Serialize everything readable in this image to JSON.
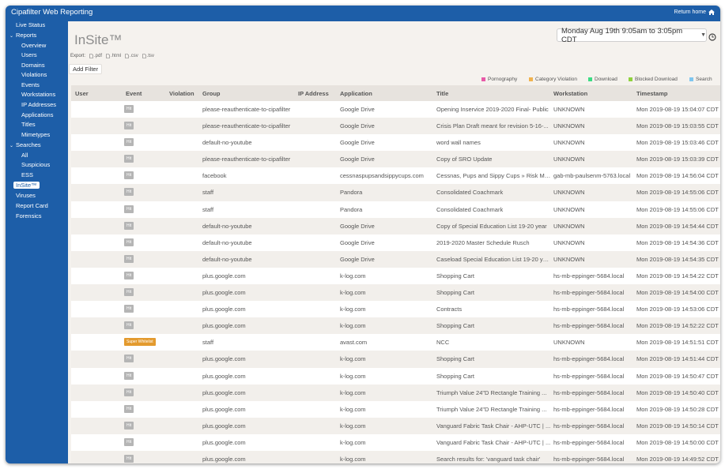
{
  "app": {
    "title": "Cipafilter Web Reporting",
    "return_home": "Return home"
  },
  "sidebar": {
    "live_status": "Live Status",
    "reports": "Reports",
    "overview": "Overview",
    "users": "Users",
    "domains": "Domains",
    "violations": "Violations",
    "events": "Events",
    "workstations": "Workstations",
    "ip_addresses": "IP Addresses",
    "applications": "Applications",
    "titles": "Titles",
    "mimetypes": "Mimetypes",
    "searches": "Searches",
    "all": "All",
    "suspicious": "Suspicious",
    "ess": "ESS",
    "insite": "InSite™",
    "viruses": "Viruses",
    "report_card": "Report Card",
    "forensics": "Forensics"
  },
  "page": {
    "title": "InSite™",
    "date_range": "Monday Aug 19th 9:05am to 3:05pm CDT",
    "export_label": "Export:",
    "export_options": [
      ".pdf",
      ".html",
      ".csv",
      ".tsv"
    ],
    "add_filter": "Add Filter"
  },
  "legend": [
    {
      "label": "Pornography",
      "color": "#e85aa8"
    },
    {
      "label": "Category Violation",
      "color": "#f0b24e"
    },
    {
      "label": "Download",
      "color": "#3ddc84"
    },
    {
      "label": "Blocked Download",
      "color": "#8fd23e"
    },
    {
      "label": "Search",
      "color": "#7fc6ef"
    }
  ],
  "table": {
    "columns": [
      "User",
      "Event",
      "Violation",
      "Group",
      "IP Address",
      "Application",
      "Title",
      "Workstation",
      "Timestamp"
    ],
    "rows": [
      {
        "event": "Hit",
        "group": "please-reauthenticate-to-cipafilter",
        "application": "Google Drive",
        "title": "Opening Inservice 2019-2020 Final- Public",
        "workstation": "UNKNOWN",
        "timestamp": "Mon 2019-08-19 15:04:07 CDT"
      },
      {
        "event": "Hit",
        "group": "please-reauthenticate-to-cipafilter",
        "application": "Google Drive",
        "title": "Crisis Plan Draft meant for revision 5-16-...",
        "workstation": "UNKNOWN",
        "timestamp": "Mon 2019-08-19 15:03:55 CDT"
      },
      {
        "event": "Hit",
        "group": "default-no-youtube",
        "application": "Google Drive",
        "title": "word wall names",
        "workstation": "UNKNOWN",
        "timestamp": "Mon 2019-08-19 15:03:46 CDT"
      },
      {
        "event": "Hit",
        "group": "please-reauthenticate-to-cipafilter",
        "application": "Google Drive",
        "title": "Copy of SRO Update",
        "workstation": "UNKNOWN",
        "timestamp": "Mon 2019-08-19 15:03:39 CDT"
      },
      {
        "event": "Hit",
        "group": "facebook",
        "application": "cessnaspupsandsippycups.com",
        "title": "Cessnas, Pups and Sippy Cups » Risk Ma...",
        "workstation": "gab-mb-paulsenm-5763.local",
        "timestamp": "Mon 2019-08-19 14:56:04 CDT"
      },
      {
        "event": "Hit",
        "group": "staff",
        "application": "Pandora",
        "title": "Consolidated Coachmark",
        "workstation": "UNKNOWN",
        "timestamp": "Mon 2019-08-19 14:55:06 CDT"
      },
      {
        "event": "Hit",
        "group": "staff",
        "application": "Pandora",
        "title": "Consolidated Coachmark",
        "workstation": "UNKNOWN",
        "timestamp": "Mon 2019-08-19 14:55:06 CDT"
      },
      {
        "event": "Hit",
        "group": "default-no-youtube",
        "application": "Google Drive",
        "title": "Copy of Special Education List 19-20 year",
        "workstation": "UNKNOWN",
        "timestamp": "Mon 2019-08-19 14:54:44 CDT"
      },
      {
        "event": "Hit",
        "group": "default-no-youtube",
        "application": "Google Drive",
        "title": "2019-2020 Master Schedule Rusch",
        "workstation": "UNKNOWN",
        "timestamp": "Mon 2019-08-19 14:54:36 CDT"
      },
      {
        "event": "Hit",
        "group": "default-no-youtube",
        "application": "Google Drive",
        "title": "Caseload Special Education List 19-20 ye...",
        "workstation": "UNKNOWN",
        "timestamp": "Mon 2019-08-19 14:54:35 CDT"
      },
      {
        "event": "Hit",
        "group": "plus.google.com",
        "application": "k-log.com",
        "title": "Shopping Cart",
        "workstation": "hs-mb-eppinger-5684.local",
        "timestamp": "Mon 2019-08-19 14:54:22 CDT"
      },
      {
        "event": "Hit",
        "group": "plus.google.com",
        "application": "k-log.com",
        "title": "Shopping Cart",
        "workstation": "hs-mb-eppinger-5684.local",
        "timestamp": "Mon 2019-08-19 14:54:00 CDT"
      },
      {
        "event": "Hit",
        "group": "plus.google.com",
        "application": "k-log.com",
        "title": "Contracts",
        "workstation": "hs-mb-eppinger-5684.local",
        "timestamp": "Mon 2019-08-19 14:53:06 CDT"
      },
      {
        "event": "Hit",
        "group": "plus.google.com",
        "application": "k-log.com",
        "title": "Shopping Cart",
        "workstation": "hs-mb-eppinger-5684.local",
        "timestamp": "Mon 2019-08-19 14:52:22 CDT"
      },
      {
        "event": "Super Whitelist",
        "group": "staff",
        "application": "avast.com",
        "title": "NCC",
        "workstation": "UNKNOWN",
        "timestamp": "Mon 2019-08-19 14:51:51 CDT"
      },
      {
        "event": "Hit",
        "group": "plus.google.com",
        "application": "k-log.com",
        "title": "Shopping Cart",
        "workstation": "hs-mb-eppinger-5684.local",
        "timestamp": "Mon 2019-08-19 14:51:44 CDT"
      },
      {
        "event": "Hit",
        "group": "plus.google.com",
        "application": "k-log.com",
        "title": "Shopping Cart",
        "workstation": "hs-mb-eppinger-5684.local",
        "timestamp": "Mon 2019-08-19 14:50:47 CDT"
      },
      {
        "event": "Hit",
        "group": "plus.google.com",
        "application": "k-log.com",
        "title": "Triumph Value 24\"D Rectangle Training ...",
        "workstation": "hs-mb-eppinger-5684.local",
        "timestamp": "Mon 2019-08-19 14:50:40 CDT"
      },
      {
        "event": "Hit",
        "group": "plus.google.com",
        "application": "k-log.com",
        "title": "Triumph Value 24\"D Rectangle Training ...",
        "workstation": "hs-mb-eppinger-5684.local",
        "timestamp": "Mon 2019-08-19 14:50:28 CDT"
      },
      {
        "event": "Hit",
        "group": "plus.google.com",
        "application": "k-log.com",
        "title": "Vanguard Fabric Task Chair - AHP-UTC | ...",
        "workstation": "hs-mb-eppinger-5684.local",
        "timestamp": "Mon 2019-08-19 14:50:14 CDT"
      },
      {
        "event": "Hit",
        "group": "plus.google.com",
        "application": "k-log.com",
        "title": "Vanguard Fabric Task Chair - AHP-UTC | ...",
        "workstation": "hs-mb-eppinger-5684.local",
        "timestamp": "Mon 2019-08-19 14:50:00 CDT"
      },
      {
        "event": "Hit",
        "group": "plus.google.com",
        "application": "k-log.com",
        "title": "Search results for: 'vanguard task chair'",
        "workstation": "hs-mb-eppinger-5684.local",
        "timestamp": "Mon 2019-08-19 14:49:52 CDT"
      }
    ]
  }
}
